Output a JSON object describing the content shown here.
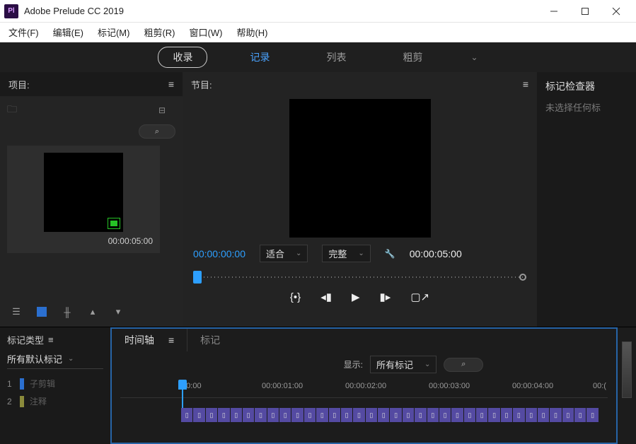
{
  "titlebar": {
    "app_icon": "Pl",
    "title": "Adobe Prelude CC 2019"
  },
  "menubar": [
    {
      "label": "文件(F)"
    },
    {
      "label": "编辑(E)"
    },
    {
      "label": "标记(M)"
    },
    {
      "label": "粗剪(R)"
    },
    {
      "label": "窗口(W)"
    },
    {
      "label": "帮助(H)"
    }
  ],
  "top_tabs": [
    {
      "label": "收录",
      "style": "pill"
    },
    {
      "label": "记录",
      "style": "blue"
    },
    {
      "label": "列表",
      "style": "plain"
    },
    {
      "label": "粗剪",
      "style": "plain"
    }
  ],
  "project": {
    "title": "项目:",
    "search_placeholder": "",
    "clip_timecode": "00:00:05:00"
  },
  "program": {
    "title": "节目:",
    "tc_current": "00:00:00:00",
    "fit_label": "适合",
    "full_label": "完整",
    "tc_total": "00:00:05:00"
  },
  "inspector": {
    "title": "标记检查器",
    "empty": "未选择任何标"
  },
  "marker_type": {
    "title": "标记类型",
    "dropdown": "所有默认标记",
    "items": [
      {
        "n": "1",
        "label": "子剪辑",
        "color": "blue"
      },
      {
        "n": "2",
        "label": "注释",
        "color": "yellow"
      }
    ]
  },
  "timeline": {
    "tab1": "时间轴",
    "tab2": "标记",
    "show_label": "显示:",
    "show_dropdown": "所有标记",
    "ruler": [
      {
        "pos": 84,
        "label": ":00:00"
      },
      {
        "pos": 200,
        "label": "00:00:01:00"
      },
      {
        "pos": 318,
        "label": "00:00:02:00"
      },
      {
        "pos": 436,
        "label": "00:00:03:00"
      },
      {
        "pos": 554,
        "label": "00:00:04:00"
      },
      {
        "pos": 668,
        "label": "00:("
      }
    ]
  }
}
